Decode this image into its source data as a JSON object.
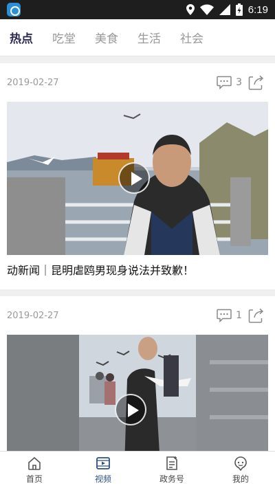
{
  "status_bar": {
    "time": "6:19"
  },
  "tabs": [
    {
      "label": "热点",
      "active": true
    },
    {
      "label": "吃堂",
      "active": false
    },
    {
      "label": "美食",
      "active": false
    },
    {
      "label": "生活",
      "active": false
    },
    {
      "label": "社会",
      "active": false
    }
  ],
  "feed": [
    {
      "date": "2019-02-27",
      "comments": "3",
      "title": "动新闻｜昆明虐鸥男现身说法并致歉！"
    },
    {
      "date": "2019-02-27",
      "comments": "1",
      "title": ""
    }
  ],
  "bottom_nav": [
    {
      "label": "首页",
      "icon": "home-icon"
    },
    {
      "label": "视频",
      "icon": "video-icon"
    },
    {
      "label": "政务号",
      "icon": "gov-account-icon"
    },
    {
      "label": "我的",
      "icon": "profile-icon"
    }
  ],
  "colors": {
    "accent": "#2b4f8a",
    "tab_active": "#2b2b54",
    "muted": "#999999"
  }
}
